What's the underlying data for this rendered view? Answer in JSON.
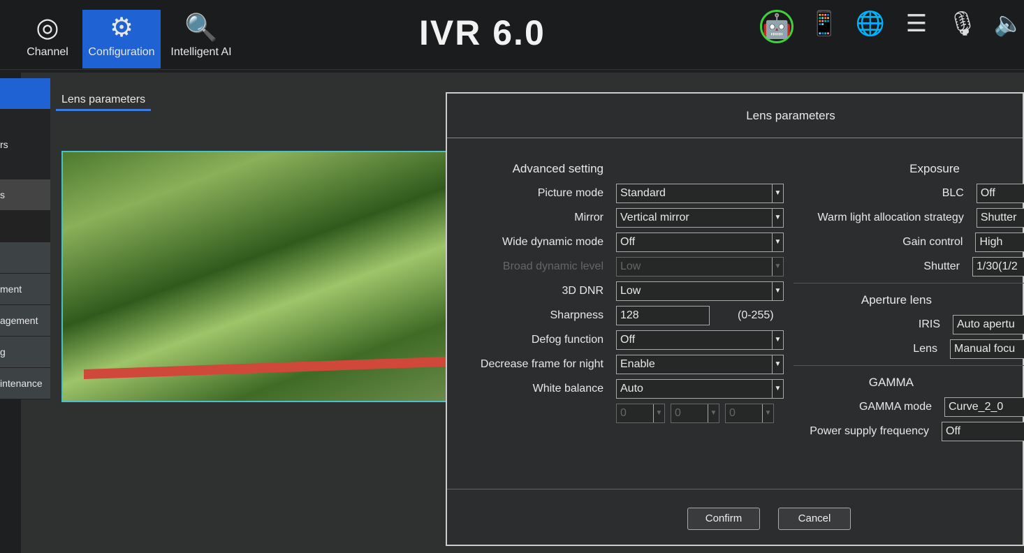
{
  "header": {
    "title": "IVR 6.0",
    "nav": [
      {
        "label": "Channel",
        "icon": "camera-add-icon"
      },
      {
        "label": "Configuration",
        "icon": "gears-icon"
      },
      {
        "label": "Intelligent AI",
        "icon": "document-search-icon"
      }
    ],
    "status_icons": [
      "android-icon",
      "phone-check-icon",
      "globe-check-icon",
      "sliders-icon",
      "microphone-icon",
      "speaker-icon"
    ]
  },
  "sidebar": {
    "items": [
      "",
      "rs",
      "s",
      "",
      "",
      "ment",
      "agement",
      "g",
      "intenance"
    ]
  },
  "tab": "Lens parameters",
  "dialog": {
    "title": "Lens parameters",
    "advanced": {
      "heading": "Advanced setting",
      "picture_mode": {
        "label": "Picture mode",
        "value": "Standard"
      },
      "mirror": {
        "label": "Mirror",
        "value": "Vertical mirror"
      },
      "wdr": {
        "label": "Wide dynamic mode",
        "value": "Off"
      },
      "broad_level": {
        "label": "Broad dynamic level",
        "value": "Low"
      },
      "dnr": {
        "label": "3D DNR",
        "value": "Low"
      },
      "sharpness": {
        "label": "Sharpness",
        "value": "128",
        "range": "(0-255)"
      },
      "defog": {
        "label": "Defog function",
        "value": "Off"
      },
      "night": {
        "label": "Decrease frame for night",
        "value": "Enable"
      },
      "wb": {
        "label": "White balance",
        "value": "Auto",
        "r": "0",
        "g": "0",
        "b": "0"
      }
    },
    "exposure": {
      "heading": "Exposure",
      "blc": {
        "label": "BLC",
        "value": "Off"
      },
      "warm": {
        "label": "Warm light allocation strategy",
        "value": "Shutter"
      },
      "gain": {
        "label": "Gain control",
        "value": "High"
      },
      "shutter": {
        "label": "Shutter",
        "value": "1/30(1/2"
      }
    },
    "aperture": {
      "heading": "Aperture lens",
      "iris": {
        "label": "IRIS",
        "value": "Auto apertu"
      },
      "lens": {
        "label": "Lens",
        "value": "Manual focu"
      }
    },
    "gamma": {
      "heading": "GAMMA",
      "mode": {
        "label": "GAMMA mode",
        "value": "Curve_2_0"
      },
      "power": {
        "label": "Power supply frequency",
        "value": "Off"
      }
    },
    "confirm": "Confirm",
    "cancel": "Cancel"
  },
  "colors": {
    "accent": "#1f62d4",
    "android": "#3fd13a",
    "preview_border": "#4cc0c8"
  }
}
